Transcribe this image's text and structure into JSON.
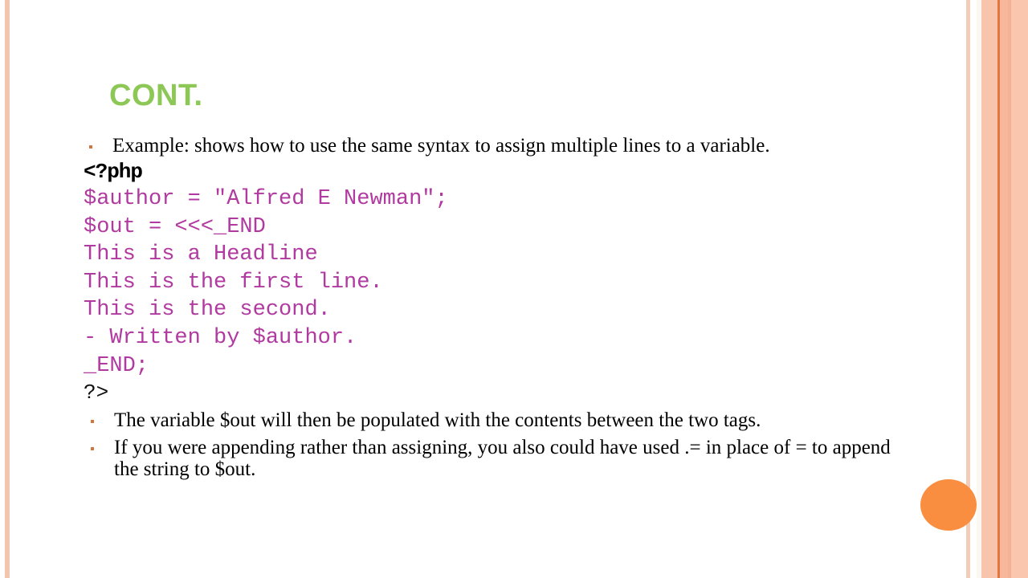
{
  "slide": {
    "title": "CONT.",
    "title_color": "#8dc857",
    "background": "#ffffff",
    "accent_ellipse_color": "#f98e40",
    "bullet_marker_color": "#d2763f",
    "code_color": "#b13aa0"
  },
  "intro_bullets": [
    "Example: shows how to use the same syntax to assign multiple lines to a variable."
  ],
  "code": {
    "open_tag": "<?php",
    "lines": [
      "$author = \"Alfred E Newman\";",
      "$out = <<<_END",
      "This is a Headline",
      "This is the first line.",
      "This is the second.",
      "- Written by $author.",
      "_END;"
    ],
    "close_tag": "?>"
  },
  "outro_bullets": [
    "The variable $out will then be populated with the contents between the two tags.",
    "If you were appending rather than assigning, you also could have used .= in place of = to append the string to $out."
  ],
  "decor": {
    "stripes": [
      {
        "name": "left-accent-stripe",
        "color": "#f4c5ae"
      },
      {
        "name": "right-stripe-1",
        "color": "#f2cdb9"
      },
      {
        "name": "right-stripe-2",
        "color": "#fbf7f1"
      },
      {
        "name": "right-stripe-3",
        "color": "#f9c4ac"
      },
      {
        "name": "right-stripe-4",
        "color": "#e3783f"
      },
      {
        "name": "right-stripe-5",
        "color": "#f6b79c"
      },
      {
        "name": "right-stripe-6",
        "color": "#f4b295"
      },
      {
        "name": "right-stripe-7",
        "color": "#fbc6ae"
      }
    ]
  }
}
